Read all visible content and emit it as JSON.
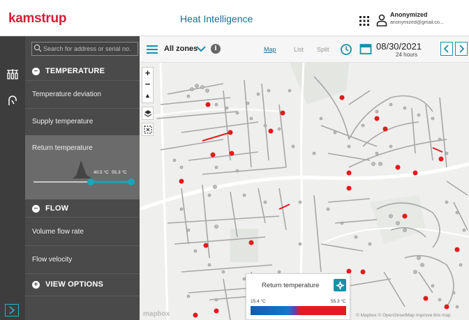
{
  "header": {
    "logo": "kamstrup",
    "app_title": "Heat Intelligence",
    "user_name": "Anonymized",
    "user_email": "anonymized@gmail.co..."
  },
  "search": {
    "placeholder": "Search for address or serial no."
  },
  "panel": {
    "sections": {
      "temperature": "TEMPERATURE",
      "flow": "FLOW",
      "view_options": "VIEW OPTIONS"
    },
    "temperature_items": [
      "Temperature deviation",
      "Supply temperature",
      "Return temperature"
    ],
    "flow_items": [
      "Volume flow rate",
      "Flow velocity"
    ],
    "selected_item": "Return temperature",
    "range": {
      "low_label": "40.5 °C",
      "high_label": "55.3 °C"
    }
  },
  "toolbar": {
    "zones": "All zones",
    "tabs": [
      "Map",
      "List",
      "Split"
    ],
    "active_tab": "Map",
    "date": "08/30/2021",
    "date_sub": "24 hours"
  },
  "map": {
    "attribution": "© Mapbox © OpenStreetMap Improve this map",
    "mapbox_logo": "mapbox"
  },
  "legend": {
    "title": "Return temperature",
    "min": "15.4 °C",
    "max": "55.3 °C"
  },
  "colors": {
    "accent": "#1a8fa8",
    "brand": "#d0203a",
    "alert": "#e41a1c"
  },
  "icons": [
    "apps-grid-icon",
    "user-icon",
    "meter-icon",
    "flow-icon",
    "expand-icon",
    "search-icon",
    "menu-icon",
    "chevron-down-icon",
    "info-icon",
    "clock-icon",
    "calendar-icon",
    "chevron-left-icon",
    "chevron-right-icon",
    "zoom-in-icon",
    "zoom-out-icon",
    "compass-icon",
    "layers-icon",
    "select-area-icon",
    "gear-icon"
  ]
}
